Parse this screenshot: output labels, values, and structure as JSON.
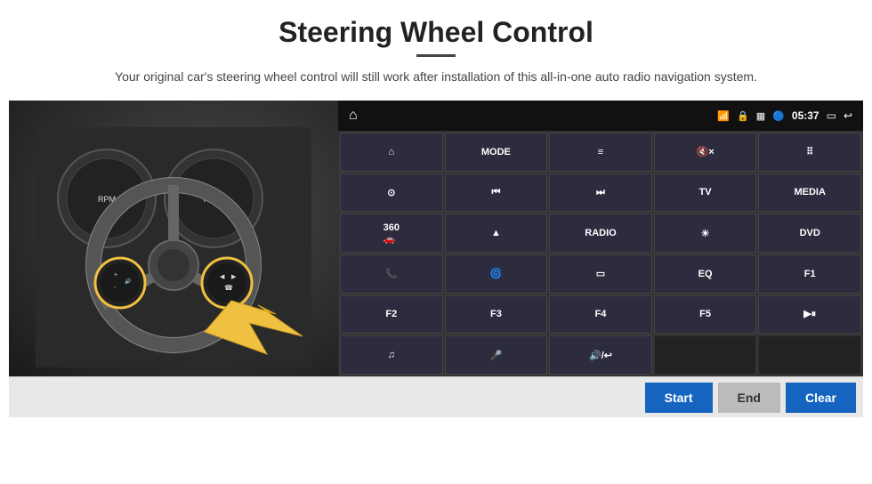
{
  "header": {
    "title": "Steering Wheel Control",
    "subtitle": "Your original car's steering wheel control will still work after installation of this all-in-one auto radio navigation system."
  },
  "top_bar": {
    "home_icon": "⌂",
    "wifi_icon": "wifi",
    "lock_icon": "🔒",
    "sim_icon": "📶",
    "bt_icon": "bt",
    "time": "05:37",
    "screen_icon": "▭",
    "back_icon": "↩"
  },
  "grid": {
    "rows": [
      [
        {
          "label": "↑",
          "icon": true
        },
        {
          "label": "MODE"
        },
        {
          "label": "≡",
          "icon": true
        },
        {
          "label": "🔇",
          "icon": true
        },
        {
          "label": "⊞",
          "icon": true
        }
      ],
      [
        {
          "label": "⊙",
          "icon": true
        },
        {
          "label": "⏮",
          "icon": true
        },
        {
          "label": "⏭",
          "icon": true
        },
        {
          "label": "TV"
        },
        {
          "label": "MEDIA"
        }
      ],
      [
        {
          "label": "360\n🚗",
          "icon": true
        },
        {
          "label": "▲",
          "icon": true
        },
        {
          "label": "RADIO"
        },
        {
          "label": "☀",
          "icon": true
        },
        {
          "label": "DVD"
        }
      ],
      [
        {
          "label": "📞",
          "icon": true
        },
        {
          "label": "🌀",
          "icon": true
        },
        {
          "label": "▭",
          "icon": true
        },
        {
          "label": "EQ"
        },
        {
          "label": "F1"
        }
      ],
      [
        {
          "label": "F2"
        },
        {
          "label": "F3"
        },
        {
          "label": "F4"
        },
        {
          "label": "F5"
        },
        {
          "label": "▶⏸",
          "icon": true
        }
      ],
      [
        {
          "label": "♫",
          "icon": true
        },
        {
          "label": "🎤",
          "icon": true
        },
        {
          "label": "🔊/↩",
          "icon": true
        },
        {
          "label": ""
        },
        {
          "label": ""
        }
      ]
    ]
  },
  "bottom_buttons": {
    "start_label": "Start",
    "end_label": "End",
    "clear_label": "Clear"
  }
}
